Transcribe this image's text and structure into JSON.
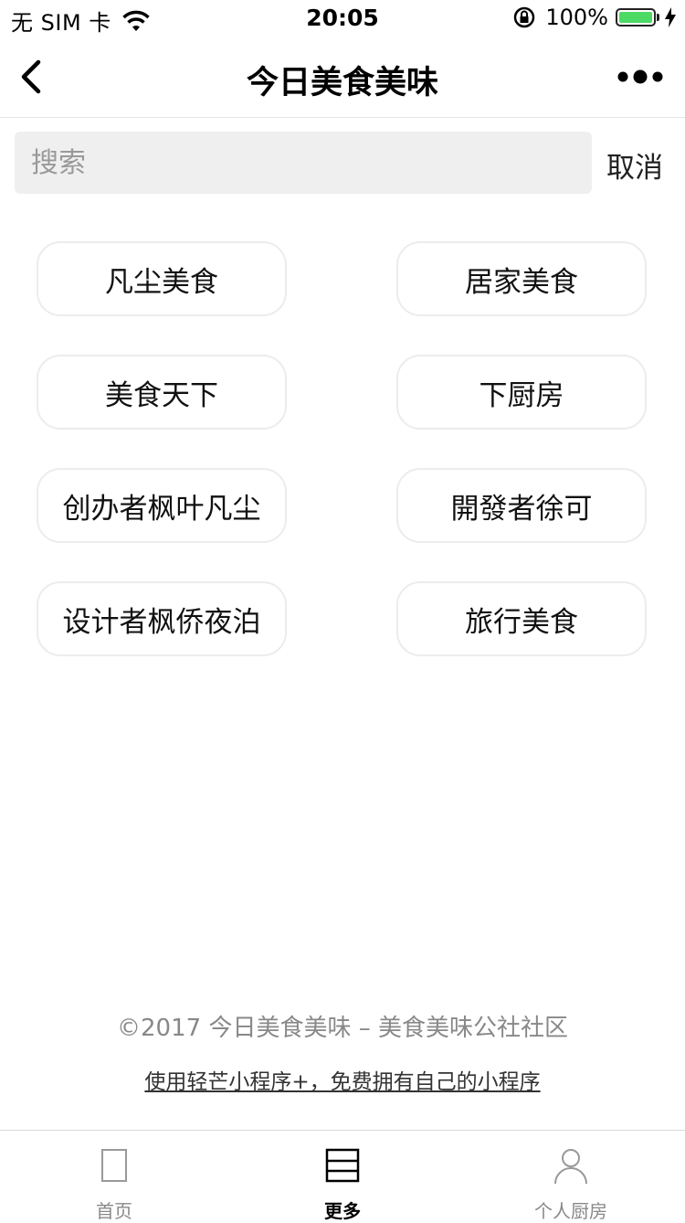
{
  "status_bar": {
    "carrier": "无 SIM 卡",
    "time": "20:05",
    "battery_percent": "100%",
    "battery_level": 1.0,
    "battery_color": "#4cd964"
  },
  "nav": {
    "title": "今日美食美味",
    "back_icon": "chevron-left-icon",
    "more_icon": "more-dots-icon"
  },
  "search": {
    "placeholder": "搜索",
    "value": "",
    "cancel_label": "取消"
  },
  "tags": [
    {
      "label": "凡尘美食"
    },
    {
      "label": "居家美食"
    },
    {
      "label": "美食天下"
    },
    {
      "label": "下厨房"
    },
    {
      "label": "创办者枫叶凡尘"
    },
    {
      "label": "開發者徐可"
    },
    {
      "label": "设计者枫侨夜泊"
    },
    {
      "label": "旅行美食"
    }
  ],
  "footer": {
    "copyright": "©2017 今日美食美味 – 美食美味公社社区",
    "promo_link": "使用轻芒小程序+，免费拥有自己的小程序"
  },
  "tab_bar": {
    "items": [
      {
        "label": "首页",
        "icon": "home-page-icon",
        "active": false
      },
      {
        "label": "更多",
        "icon": "list-icon",
        "active": true
      },
      {
        "label": "个人厨房",
        "icon": "person-icon",
        "active": false
      }
    ]
  }
}
